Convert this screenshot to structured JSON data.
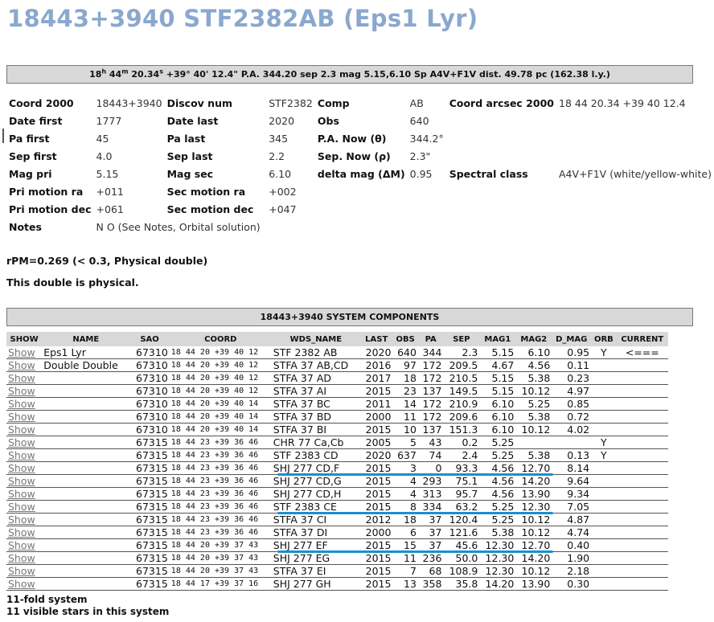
{
  "title": "18443+3940 STF2382AB (Eps1 Lyr)",
  "position_bar": {
    "ra_h": "18",
    "ra_h_unit": "h",
    "ra_m": " 44",
    "ra_m_unit": "m",
    "ra_s": " 20.34",
    "ra_s_unit": "s",
    "rest": " +39° 40' 12.4\" P.A. 344.20 sep 2.3 mag 5.15,6.10 Sp A4V+F1V dist. 49.78 pc (162.38 l.y.)"
  },
  "info": {
    "rows": [
      [
        "Coord 2000",
        "18443+3940",
        "Discov num",
        "STF2382",
        "Comp",
        "AB",
        "Coord arcsec 2000",
        "18 44 20.34 +39 40 12.4"
      ],
      [
        "Date first",
        "1777",
        "Date last",
        "2020",
        "Obs",
        "640",
        "",
        ""
      ],
      [
        "Pa first",
        "45",
        "Pa last",
        "345",
        "P.A. Now (θ)",
        "344.2°",
        "",
        ""
      ],
      [
        "Sep first",
        "4.0",
        "Sep last",
        "2.2",
        "Sep. Now (ρ)",
        "2.3\"",
        "",
        ""
      ],
      [
        "Mag pri",
        "5.15",
        "Mag sec",
        "6.10",
        "delta mag (ΔM)",
        "0.95",
        "Spectral class",
        "A4V+F1V (white/yellow-white)"
      ],
      [
        "Pri motion ra",
        "+011",
        "Sec motion ra",
        "+002",
        "",
        "",
        "",
        ""
      ],
      [
        "Pri motion dec",
        "+061",
        "Sec motion dec",
        "+047",
        "",
        "",
        "",
        ""
      ],
      [
        "Notes",
        "N O (See Notes, Orbital solution)",
        "",
        "",
        "",
        "",
        "",
        ""
      ]
    ]
  },
  "rpm_text": "rPM=0.269 (< 0.3, Physical double)",
  "physical_text": "This double is physical.",
  "system_header": "18443+3940 SYSTEM COMPONENTS",
  "components": {
    "headers": [
      "SHOW",
      "NAME",
      "SAO",
      "COORD",
      "WDS_NAME",
      "LAST",
      "OBS",
      "PA",
      "SEP",
      "MAG1",
      "MAG2",
      "D_MAG",
      "ORB",
      "CURRENT"
    ],
    "rows": [
      [
        "Show",
        "Eps1 Lyr",
        "67310",
        "18 44 20 +39 40 12",
        "STF 2382 AB",
        "2020",
        "640",
        "344",
        "2.3",
        "5.15",
        "6.10",
        "0.95",
        "Y",
        "<==="
      ],
      [
        "Show",
        "Double Double",
        "67310",
        "18 44 20 +39 40 12",
        "STFA 37 AB,CD",
        "2016",
        "97",
        "172",
        "209.5",
        "4.67",
        "4.56",
        "0.11",
        "",
        ""
      ],
      [
        "Show",
        "",
        "67310",
        "18 44 20 +39 40 12",
        "STFA 37 AD",
        "2017",
        "18",
        "172",
        "210.5",
        "5.15",
        "5.38",
        "0.23",
        "",
        ""
      ],
      [
        "Show",
        "",
        "67310",
        "18 44 20 +39 40 12",
        "STFA 37 AI",
        "2015",
        "23",
        "137",
        "149.5",
        "5.15",
        "10.12",
        "4.97",
        "",
        ""
      ],
      [
        "Show",
        "",
        "67310",
        "18 44 20 +39 40 14",
        "STFA 37 BC",
        "2011",
        "14",
        "172",
        "210.9",
        "6.10",
        "5.25",
        "0.85",
        "",
        ""
      ],
      [
        "Show",
        "",
        "67310",
        "18 44 20 +39 40 14",
        "STFA 37 BD",
        "2000",
        "11",
        "172",
        "209.6",
        "6.10",
        "5.38",
        "0.72",
        "",
        ""
      ],
      [
        "Show",
        "",
        "67310",
        "18 44 20 +39 40 14",
        "STFA 37 BI",
        "2015",
        "10",
        "137",
        "151.3",
        "6.10",
        "10.12",
        "4.02",
        "",
        ""
      ],
      [
        "Show",
        "",
        "67315",
        "18 44 23 +39 36 46",
        "CHR 77 Ca,Cb",
        "2005",
        "5",
        "43",
        "0.2",
        "5.25",
        "",
        "",
        "Y",
        ""
      ],
      [
        "Show",
        "",
        "67315",
        "18 44 23 +39 36 46",
        "STF 2383 CD",
        "2020",
        "637",
        "74",
        "2.4",
        "5.25",
        "5.38",
        "0.13",
        "Y",
        ""
      ],
      [
        "Show",
        "",
        "67315",
        "18 44 23 +39 36 46",
        "SHJ 277 CD,F",
        "2015",
        "3",
        "0",
        "93.3",
        "4.56",
        "12.70",
        "8.14",
        "",
        ""
      ],
      [
        "Show",
        "",
        "67315",
        "18 44 23 +39 36 46",
        "SHJ 277 CD,G",
        "2015",
        "4",
        "293",
        "75.1",
        "4.56",
        "14.20",
        "9.64",
        "",
        ""
      ],
      [
        "Show",
        "",
        "67315",
        "18 44 23 +39 36 46",
        "SHJ 277 CD,H",
        "2015",
        "4",
        "313",
        "95.7",
        "4.56",
        "13.90",
        "9.34",
        "",
        ""
      ],
      [
        "Show",
        "",
        "67315",
        "18 44 23 +39 36 46",
        "STF 2383 CE",
        "2015",
        "8",
        "334",
        "63.2",
        "5.25",
        "12.30",
        "7.05",
        "",
        ""
      ],
      [
        "Show",
        "",
        "67315",
        "18 44 23 +39 36 46",
        "STFA 37 CI",
        "2012",
        "18",
        "37",
        "120.4",
        "5.25",
        "10.12",
        "4.87",
        "",
        ""
      ],
      [
        "Show",
        "",
        "67315",
        "18 44 23 +39 36 46",
        "STFA 37 DI",
        "2000",
        "6",
        "37",
        "121.6",
        "5.38",
        "10.12",
        "4.74",
        "",
        ""
      ],
      [
        "Show",
        "",
        "67315",
        "18 44 20 +39 37 43",
        "SHJ 277 EF",
        "2015",
        "15",
        "37",
        "45.6",
        "12.30",
        "12.70",
        "0.40",
        "",
        ""
      ],
      [
        "Show",
        "",
        "67315",
        "18 44 20 +39 37 43",
        "SHJ 277 EG",
        "2015",
        "11",
        "236",
        "50.0",
        "12.30",
        "14.20",
        "1.90",
        "",
        ""
      ],
      [
        "Show",
        "",
        "67315",
        "18 44 20 +39 37 43",
        "STFA 37 EI",
        "2015",
        "7",
        "68",
        "108.9",
        "12.30",
        "10.12",
        "2.18",
        "",
        ""
      ],
      [
        "Show",
        "",
        "67315",
        "18 44 17 +39 37 16",
        "SHJ 277 GH",
        "2015",
        "13",
        "358",
        "35.8",
        "14.20",
        "13.90",
        "0.30",
        "",
        ""
      ]
    ],
    "highlighted_rows": [
      9,
      12,
      15
    ],
    "highlight_color": "#1a8fd0"
  },
  "footer": {
    "fold": "11-fold system",
    "visible": "11 visible stars in this system"
  },
  "colors": {
    "title": "#8aa8cf",
    "bar_bg": "#d8d8d8",
    "link": "#777777"
  }
}
